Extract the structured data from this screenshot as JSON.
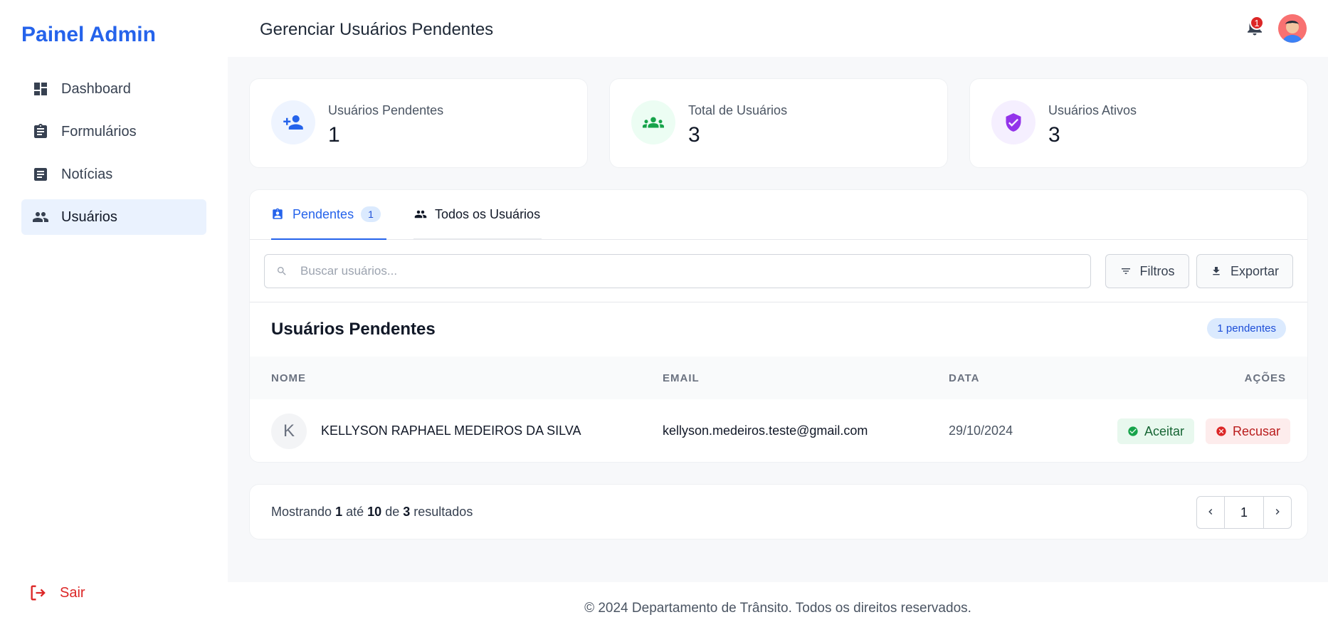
{
  "sidebar": {
    "brand": "Painel Admin",
    "items": [
      {
        "label": "Dashboard",
        "icon": "dashboard-icon"
      },
      {
        "label": "Formulários",
        "icon": "clipboard-icon"
      },
      {
        "label": "Notícias",
        "icon": "article-icon"
      },
      {
        "label": "Usuários",
        "icon": "users-icon",
        "active": true
      }
    ],
    "logout": "Sair"
  },
  "header": {
    "title": "Gerenciar Usuários Pendentes",
    "notification_count": "1"
  },
  "stats": [
    {
      "label": "Usuários Pendentes",
      "value": "1",
      "color": "#2563eb",
      "bg": "#eef4ff"
    },
    {
      "label": "Total de Usuários",
      "value": "3",
      "color": "#16a34a",
      "bg": "#ecfdf3"
    },
    {
      "label": "Usuários Ativos",
      "value": "3",
      "color": "#9333ea",
      "bg": "#f5efff"
    }
  ],
  "tabs": {
    "pending": {
      "label": "Pendentes",
      "count": "1"
    },
    "all": {
      "label": "Todos os Usuários"
    }
  },
  "toolbar": {
    "search_placeholder": "Buscar usuários...",
    "filters": "Filtros",
    "export": "Exportar"
  },
  "list": {
    "title": "Usuários Pendentes",
    "badge": "1 pendentes",
    "columns": [
      "NOME",
      "EMAIL",
      "DATA",
      "AÇÕES"
    ],
    "rows": [
      {
        "initial": "K",
        "name": "KELLYSON RAPHAEL MEDEIROS DA SILVA",
        "email": "kellyson.medeiros.teste@gmail.com",
        "date": "29/10/2024",
        "accept": "Aceitar",
        "reject": "Recusar"
      }
    ]
  },
  "pagination": {
    "prefix": "Mostrando",
    "from": "1",
    "to_word": "até",
    "to": "10",
    "of_word": "de",
    "total": "3",
    "suffix": "resultados",
    "page": "1"
  },
  "footer": "© 2024 Departamento de Trânsito. Todos os direitos reservados.",
  "colors": {
    "accent": "#2563eb",
    "danger": "#dc2626",
    "success": "#16a34a"
  }
}
